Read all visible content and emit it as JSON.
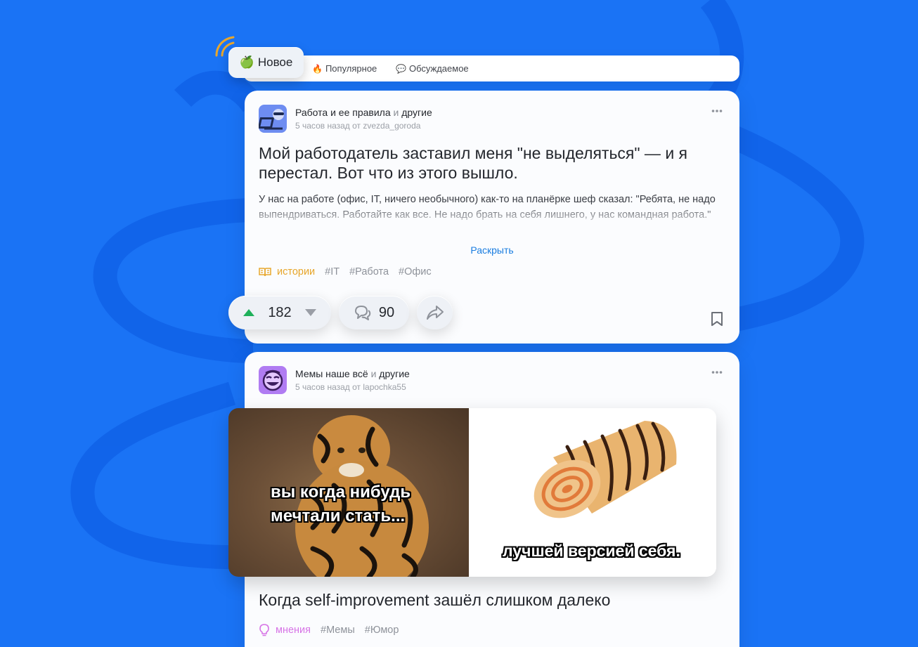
{
  "tabs": {
    "active": {
      "label": "Новое",
      "emoji": "🍏"
    },
    "popular": {
      "label": "Популярное",
      "emoji": "🔥"
    },
    "discussed": {
      "label": "Обсуждаемое",
      "emoji": "💬"
    }
  },
  "posts": [
    {
      "community": "Работа и ее правила",
      "and": "и",
      "others": "другие",
      "meta": "5 часов назад от zvezda_goroda",
      "title": "Мой работодатель заставил меня \"не выделяться\" — и я перестал. Вот что из этого вышло.",
      "body": "У нас на работе (офис, IT, ничего необычного) как-то на планёрке шеф сказал: \"Ребята, не надо выпендриваться. Работайте как все. Не надо брать на себя лишнего, у нас командная работа.\"",
      "expand": "Раскрыть",
      "category": "истории",
      "tags": [
        "#IT",
        "#Работа",
        "#Офис"
      ],
      "rating": "182",
      "comments": "90"
    },
    {
      "community": "Мемы наше всё",
      "and": "и",
      "others": "другие",
      "meta": "5 часов назад от lapochka55",
      "meme_caption_left": "вы когда нибудь мечтали стать...",
      "meme_caption_right": "лучшей версией себя.",
      "title": "Когда self-improvement зашёл слишком далеко",
      "category": "мнения",
      "tags": [
        "#Мемы",
        "#Юмор"
      ]
    }
  ],
  "colors": {
    "background": "#1a73f5",
    "accent_link": "#1a7de0",
    "upvote": "#1fb05a",
    "category_gold": "#e7a62a",
    "category_pink": "#d774e6"
  }
}
